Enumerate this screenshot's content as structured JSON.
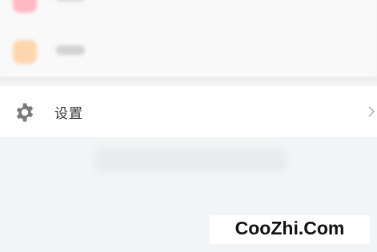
{
  "settings": {
    "label": "设置",
    "icon": "gear-icon",
    "chevron_icon": "chevron-right-icon"
  },
  "watermark": {
    "text": "CooZhi.Com"
  },
  "colors": {
    "background": "#f3f4f6",
    "row_background": "#ffffff",
    "icon_color": "#7a7a7a",
    "text_color": "#333333"
  }
}
